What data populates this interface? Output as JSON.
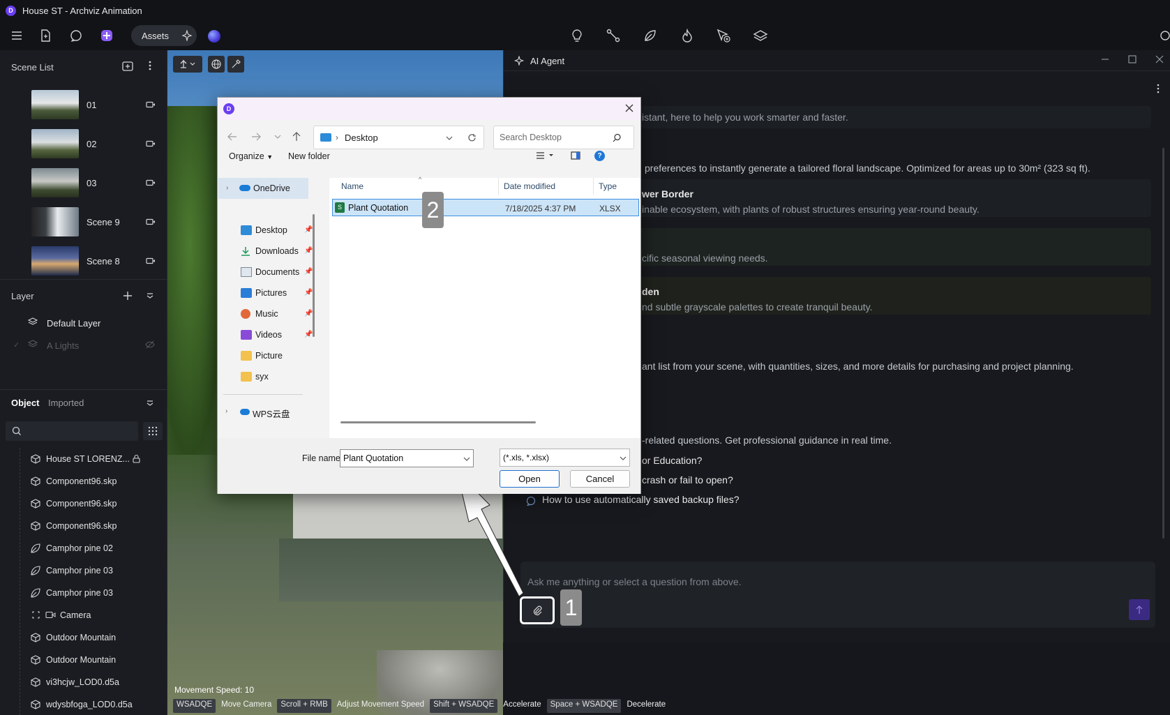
{
  "window": {
    "title": "House ST - Archviz Animation",
    "logo": "D"
  },
  "toolbar": {
    "assets_label": "Assets",
    "left_icons": [
      "menu-icon",
      "file-icon",
      "chat-icon",
      "ai-plus-icon"
    ],
    "center_icons": [
      "bulb-icon",
      "measure-icon",
      "leaf-icon",
      "flame-icon",
      "cursor-plus-icon",
      "layers-icon"
    ]
  },
  "scene_list": {
    "title": "Scene List",
    "scenes": [
      {
        "label": "01"
      },
      {
        "label": "02"
      },
      {
        "label": "03"
      },
      {
        "label": "Scene 9"
      },
      {
        "label": "Scene 8"
      }
    ]
  },
  "layer": {
    "title": "Layer",
    "items": [
      {
        "label": "Default Layer"
      },
      {
        "label": "A Lights"
      }
    ]
  },
  "objects": {
    "tabs": [
      "Object",
      "Imported"
    ],
    "items": [
      {
        "label": "House ST LORENZ...",
        "icon": "cube-icon"
      },
      {
        "label": "Component96.skp",
        "icon": "cube-icon"
      },
      {
        "label": "Component96.skp",
        "icon": "cube-icon"
      },
      {
        "label": "Component96.skp",
        "icon": "cube-icon"
      },
      {
        "label": "Camphor pine 02",
        "icon": "leaf-icon"
      },
      {
        "label": "Camphor pine 03",
        "icon": "leaf-icon"
      },
      {
        "label": "Camphor pine 03",
        "icon": "leaf-icon"
      },
      {
        "label": "Camera",
        "icon": "camera-icon"
      },
      {
        "label": "Outdoor Mountain",
        "icon": "cube-icon"
      },
      {
        "label": "Outdoor Mountain",
        "icon": "cube-icon"
      },
      {
        "label": "vi3hcjw_LOD0.d5a",
        "icon": "cube-icon"
      },
      {
        "label": "wdysbfoga_LOD0.d5a",
        "icon": "cube-icon"
      }
    ]
  },
  "viewport": {
    "speed": "Movement Speed: 10",
    "hints": [
      {
        "key": "WSADQE",
        "desc": "Move Camera"
      },
      {
        "key": "Scroll + RMB",
        "desc": "Adjust Movement Speed"
      },
      {
        "key": "Shift + WSADQE",
        "desc": "Accelerate"
      },
      {
        "key": "Space + WSADQE",
        "desc": "Decelerate"
      }
    ]
  },
  "agent": {
    "title": "AI Agent",
    "intro": "istant, here to help you work smarter and faster.",
    "lines": {
      "l1": "preferences to instantly generate a tailored floral landscape. Optimized for areas up to 30m² (323 sq ft).",
      "t1": "wer Border",
      "d1": "inable ecosystem, with plants of robust structures ensuring year-round beauty.",
      "d2": "cific seasonal viewing needs.",
      "t3": "den",
      "d3": "nd subtle grayscale palettes to create tranquil beauty.",
      "l2": "ant list from your scene, with quantities, sizes, and more details for purchasing and project planning.",
      "l3": "-related questions. Get professional guidance in real time.",
      "q1": "or Education?",
      "q2": "crash or fail to open?",
      "q3": "How to use automatically saved backup files?"
    },
    "input_placeholder": "Ask me anything or select a question from above."
  },
  "dialog": {
    "location": "Desktop",
    "search_placeholder": "Search Desktop",
    "organize": "Organize",
    "new_folder": "New folder",
    "nav": {
      "onedrive": "OneDrive",
      "items": [
        {
          "label": "Desktop",
          "icon": "desktop-icon",
          "pinned": true
        },
        {
          "label": "Downloads",
          "icon": "download-icon",
          "pinned": true
        },
        {
          "label": "Documents",
          "icon": "documents-icon",
          "pinned": true
        },
        {
          "label": "Pictures",
          "icon": "pictures-icon",
          "pinned": true
        },
        {
          "label": "Music",
          "icon": "music-icon",
          "pinned": true
        },
        {
          "label": "Videos",
          "icon": "videos-icon",
          "pinned": true
        },
        {
          "label": "Picture",
          "icon": "folder-icon",
          "pinned": false
        },
        {
          "label": "syx",
          "icon": "folder-icon",
          "pinned": false
        }
      ],
      "wps": "WPS云盘"
    },
    "columns": {
      "name": "Name",
      "date": "Date modified",
      "type": "Type"
    },
    "files": [
      {
        "name": "Plant Quotation",
        "date": "7/18/2025 4:37 PM",
        "type": "XLSX"
      }
    ],
    "file_name_label": "File name:",
    "file_name_value": "Plant Quotation",
    "filter": "(*.xls, *.xlsx)",
    "open_label": "Open",
    "cancel_label": "Cancel"
  },
  "annotations": {
    "step1": "1",
    "step2": "2"
  }
}
